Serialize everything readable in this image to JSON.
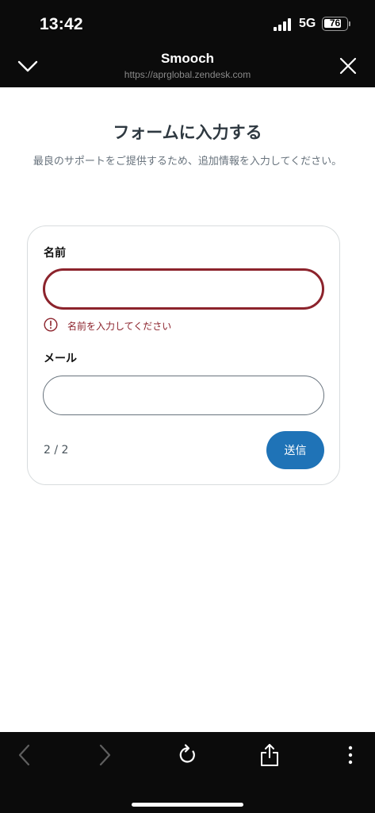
{
  "status_bar": {
    "time": "13:42",
    "network": "5G",
    "battery": "76",
    "battery_level": 0.76,
    "icons": [
      "signal-icon",
      "battery-icon"
    ]
  },
  "browser_header": {
    "title": "Smooch",
    "url": "https://aprglobal.zendesk.com",
    "icons": [
      "chevron-down-icon",
      "close-icon"
    ]
  },
  "page": {
    "title": "フォームに入力する",
    "subtitle": "最良のサポートをご提供するため、追加情報を入力してください。"
  },
  "form": {
    "name_label": "名前",
    "name_value": "",
    "name_error": "名前を入力してください",
    "email_label": "メール",
    "email_value": "",
    "step": "2 / 2",
    "submit_label": "送信"
  },
  "toolbar": {
    "icons": [
      "back-icon",
      "forward-icon",
      "reload-icon",
      "share-icon",
      "more-icon"
    ]
  },
  "colors": {
    "error": "#8c232c",
    "accent": "#1f73b7",
    "chrome": "#0b0b0b"
  }
}
